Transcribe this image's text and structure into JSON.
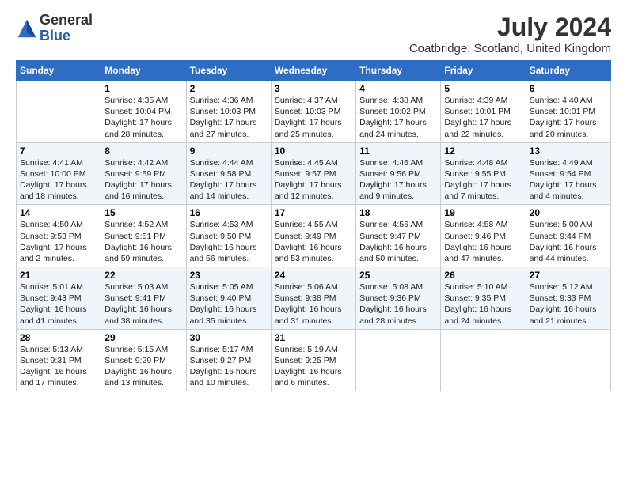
{
  "logo": {
    "general": "General",
    "blue": "Blue"
  },
  "header": {
    "month_year": "July 2024",
    "location": "Coatbridge, Scotland, United Kingdom"
  },
  "days_of_week": [
    "Sunday",
    "Monday",
    "Tuesday",
    "Wednesday",
    "Thursday",
    "Friday",
    "Saturday"
  ],
  "weeks": [
    [
      {
        "day": "",
        "info": ""
      },
      {
        "day": "1",
        "info": "Sunrise: 4:35 AM\nSunset: 10:04 PM\nDaylight: 17 hours\nand 28 minutes."
      },
      {
        "day": "2",
        "info": "Sunrise: 4:36 AM\nSunset: 10:03 PM\nDaylight: 17 hours\nand 27 minutes."
      },
      {
        "day": "3",
        "info": "Sunrise: 4:37 AM\nSunset: 10:03 PM\nDaylight: 17 hours\nand 25 minutes."
      },
      {
        "day": "4",
        "info": "Sunrise: 4:38 AM\nSunset: 10:02 PM\nDaylight: 17 hours\nand 24 minutes."
      },
      {
        "day": "5",
        "info": "Sunrise: 4:39 AM\nSunset: 10:01 PM\nDaylight: 17 hours\nand 22 minutes."
      },
      {
        "day": "6",
        "info": "Sunrise: 4:40 AM\nSunset: 10:01 PM\nDaylight: 17 hours\nand 20 minutes."
      }
    ],
    [
      {
        "day": "7",
        "info": "Sunrise: 4:41 AM\nSunset: 10:00 PM\nDaylight: 17 hours\nand 18 minutes."
      },
      {
        "day": "8",
        "info": "Sunrise: 4:42 AM\nSunset: 9:59 PM\nDaylight: 17 hours\nand 16 minutes."
      },
      {
        "day": "9",
        "info": "Sunrise: 4:44 AM\nSunset: 9:58 PM\nDaylight: 17 hours\nand 14 minutes."
      },
      {
        "day": "10",
        "info": "Sunrise: 4:45 AM\nSunset: 9:57 PM\nDaylight: 17 hours\nand 12 minutes."
      },
      {
        "day": "11",
        "info": "Sunrise: 4:46 AM\nSunset: 9:56 PM\nDaylight: 17 hours\nand 9 minutes."
      },
      {
        "day": "12",
        "info": "Sunrise: 4:48 AM\nSunset: 9:55 PM\nDaylight: 17 hours\nand 7 minutes."
      },
      {
        "day": "13",
        "info": "Sunrise: 4:49 AM\nSunset: 9:54 PM\nDaylight: 17 hours\nand 4 minutes."
      }
    ],
    [
      {
        "day": "14",
        "info": "Sunrise: 4:50 AM\nSunset: 9:53 PM\nDaylight: 17 hours\nand 2 minutes."
      },
      {
        "day": "15",
        "info": "Sunrise: 4:52 AM\nSunset: 9:51 PM\nDaylight: 16 hours\nand 59 minutes."
      },
      {
        "day": "16",
        "info": "Sunrise: 4:53 AM\nSunset: 9:50 PM\nDaylight: 16 hours\nand 56 minutes."
      },
      {
        "day": "17",
        "info": "Sunrise: 4:55 AM\nSunset: 9:49 PM\nDaylight: 16 hours\nand 53 minutes."
      },
      {
        "day": "18",
        "info": "Sunrise: 4:56 AM\nSunset: 9:47 PM\nDaylight: 16 hours\nand 50 minutes."
      },
      {
        "day": "19",
        "info": "Sunrise: 4:58 AM\nSunset: 9:46 PM\nDaylight: 16 hours\nand 47 minutes."
      },
      {
        "day": "20",
        "info": "Sunrise: 5:00 AM\nSunset: 9:44 PM\nDaylight: 16 hours\nand 44 minutes."
      }
    ],
    [
      {
        "day": "21",
        "info": "Sunrise: 5:01 AM\nSunset: 9:43 PM\nDaylight: 16 hours\nand 41 minutes."
      },
      {
        "day": "22",
        "info": "Sunrise: 5:03 AM\nSunset: 9:41 PM\nDaylight: 16 hours\nand 38 minutes."
      },
      {
        "day": "23",
        "info": "Sunrise: 5:05 AM\nSunset: 9:40 PM\nDaylight: 16 hours\nand 35 minutes."
      },
      {
        "day": "24",
        "info": "Sunrise: 5:06 AM\nSunset: 9:38 PM\nDaylight: 16 hours\nand 31 minutes."
      },
      {
        "day": "25",
        "info": "Sunrise: 5:08 AM\nSunset: 9:36 PM\nDaylight: 16 hours\nand 28 minutes."
      },
      {
        "day": "26",
        "info": "Sunrise: 5:10 AM\nSunset: 9:35 PM\nDaylight: 16 hours\nand 24 minutes."
      },
      {
        "day": "27",
        "info": "Sunrise: 5:12 AM\nSunset: 9:33 PM\nDaylight: 16 hours\nand 21 minutes."
      }
    ],
    [
      {
        "day": "28",
        "info": "Sunrise: 5:13 AM\nSunset: 9:31 PM\nDaylight: 16 hours\nand 17 minutes."
      },
      {
        "day": "29",
        "info": "Sunrise: 5:15 AM\nSunset: 9:29 PM\nDaylight: 16 hours\nand 13 minutes."
      },
      {
        "day": "30",
        "info": "Sunrise: 5:17 AM\nSunset: 9:27 PM\nDaylight: 16 hours\nand 10 minutes."
      },
      {
        "day": "31",
        "info": "Sunrise: 5:19 AM\nSunset: 9:25 PM\nDaylight: 16 hours\nand 6 minutes."
      },
      {
        "day": "",
        "info": ""
      },
      {
        "day": "",
        "info": ""
      },
      {
        "day": "",
        "info": ""
      }
    ]
  ]
}
